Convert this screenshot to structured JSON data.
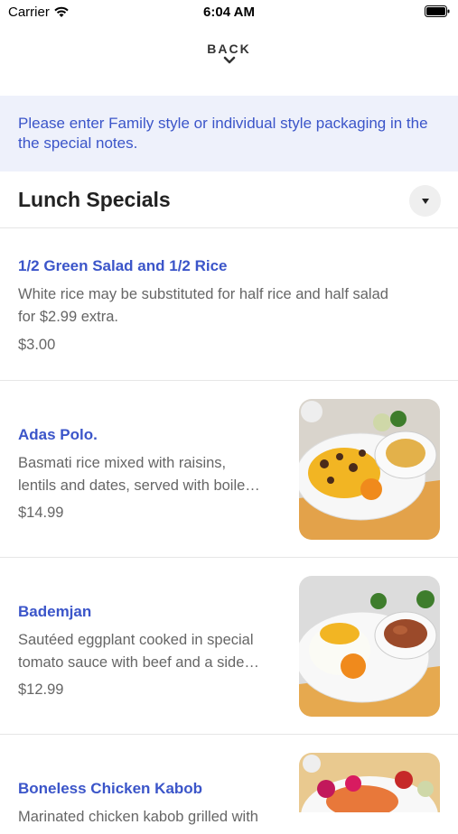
{
  "status_bar": {
    "carrier": "Carrier",
    "time": "6:04 AM"
  },
  "nav": {
    "back_label": "BACK"
  },
  "notice": "Please enter Family style or individual style packaging in the the special notes.",
  "section": {
    "title": "Lunch Specials"
  },
  "items": [
    {
      "name": "1/2 Green Salad and 1/2 Rice",
      "description_line1": "White rice may be substituted for half rice and half salad",
      "description_line2": "for $2.99 extra.",
      "price": "$3.00"
    },
    {
      "name": "Adas Polo.",
      "description_line1": "Basmati rice mixed with raisins,",
      "description_line2": "lentils and dates, served with boile…",
      "price": "$14.99",
      "image": "rice-with-chicken-photo"
    },
    {
      "name": "Bademjan",
      "description_line1": "Sautéed eggplant cooked in special",
      "description_line2": "tomato sauce with beef and a side…",
      "price": "$12.99",
      "image": "rice-with-eggplant-stew-photo"
    },
    {
      "name": "Boneless Chicken Kabob",
      "description_line1": "Marinated chicken kabob grilled with",
      "image": "chicken-kabob-platter-photo"
    }
  ],
  "colors": {
    "accent": "#3b55c9",
    "notice_bg": "#eef1fb",
    "saffron": "#f2b523"
  }
}
